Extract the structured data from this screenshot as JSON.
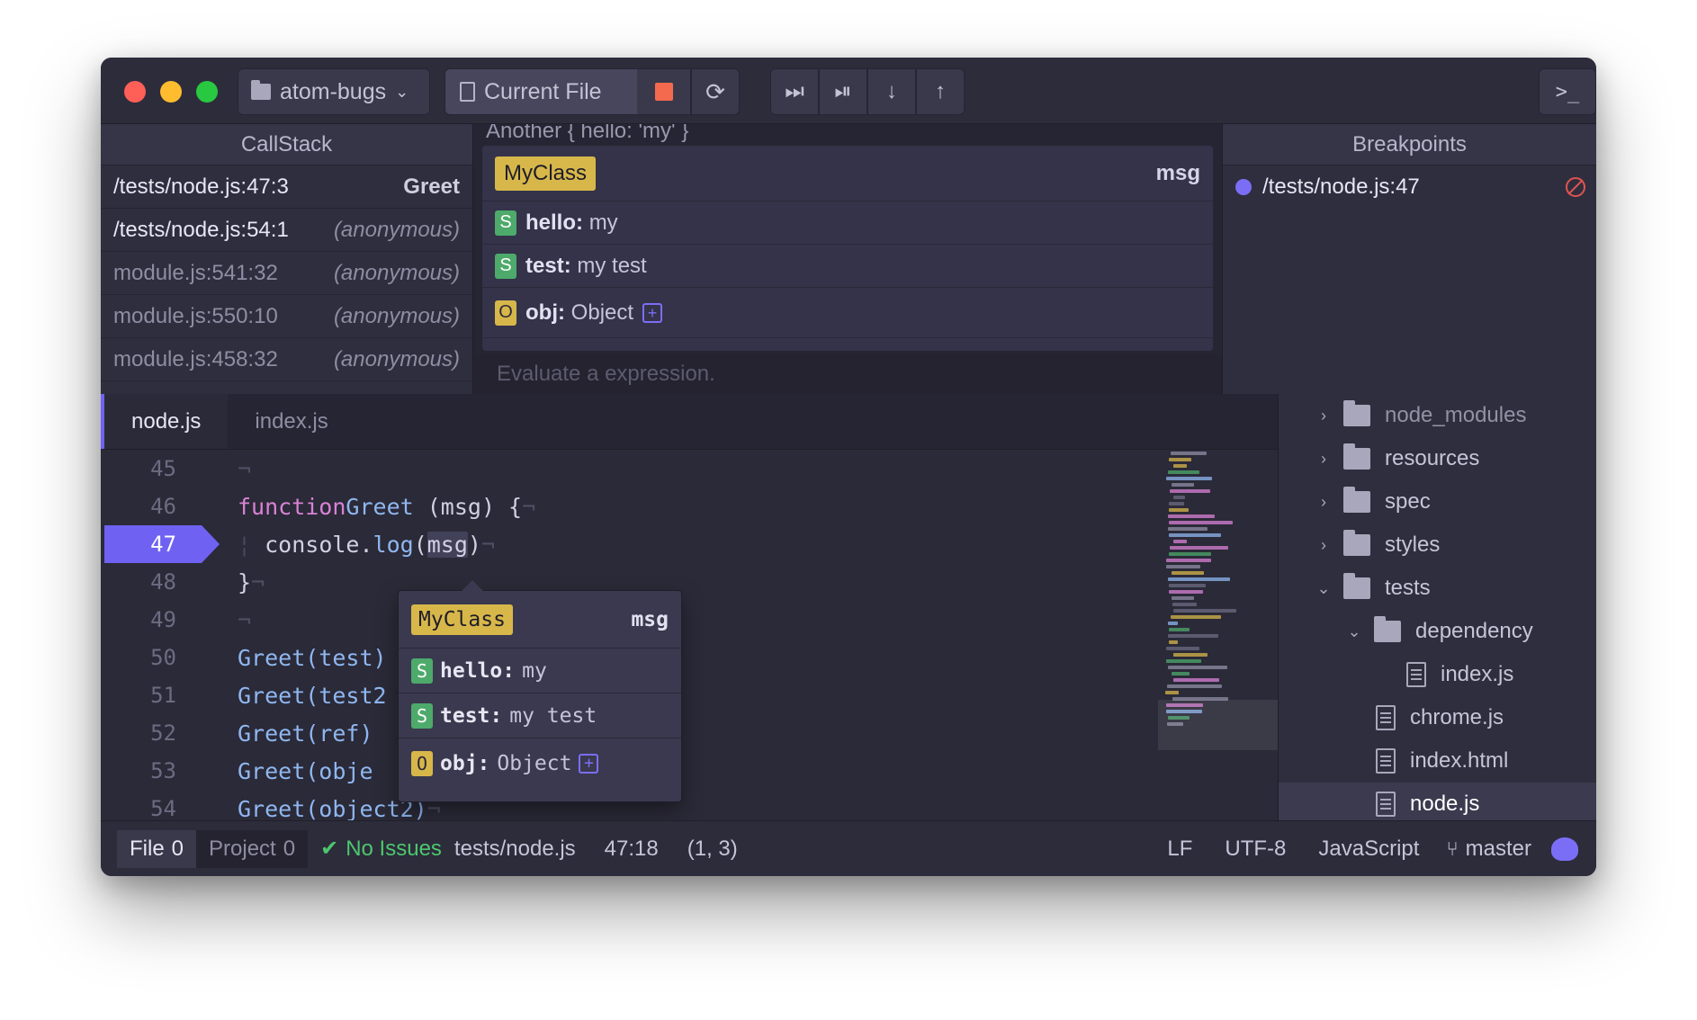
{
  "toolbar": {
    "project_label": "atom-bugs",
    "scope_label": "Current File",
    "reload_icon": "⟳",
    "step_over_icon": "⏭",
    "step_into_icon": "⏯",
    "step_down_icon": "↓",
    "step_out_icon": "↑",
    "terminal_icon": "⌨",
    "terminal_label": ">_"
  },
  "callstack": {
    "title": "CallStack",
    "frames": [
      {
        "location": "/tests/node.js:47:3",
        "function": "Greet"
      },
      {
        "location": "/tests/node.js:54:1",
        "function": "(anonymous)"
      },
      {
        "location": "module.js:541:32",
        "function": "(anonymous)"
      },
      {
        "location": "module.js:550:10",
        "function": "(anonymous)"
      },
      {
        "location": "module.js:458:32",
        "function": "(anonymous)"
      }
    ]
  },
  "variables": {
    "cut_header": "Another { hello: 'my' }",
    "class_name": "MyClass",
    "var_name": "msg",
    "rows": [
      {
        "type": "S",
        "key": "hello",
        "value": "my"
      },
      {
        "type": "S",
        "key": "test",
        "value": "my test"
      },
      {
        "type": "O",
        "key": "obj",
        "value": "Object",
        "expand": "+"
      }
    ],
    "eval_placeholder": "Evaluate a expression."
  },
  "breakpoints": {
    "title": "Breakpoints",
    "items": [
      {
        "location": "/tests/node.js:47"
      }
    ]
  },
  "editor": {
    "tabs": [
      "node.js",
      "index.js"
    ],
    "line_numbers": [
      "45",
      "46",
      "47",
      "48",
      "49",
      "50",
      "51",
      "52",
      "53",
      "54"
    ],
    "active_line": "47",
    "code": {
      "l46_kw": "function",
      "l46_fn": "Greet",
      "l46_rest": " (msg) {",
      "l47_obj": "console.",
      "l47_fn": "log",
      "l47_open": "(",
      "l47_arg": "msg",
      "l47_close": ")",
      "l48": "}",
      "l50": "Greet(test)",
      "l51": "Greet(test2",
      "l52": "Greet(ref)",
      "l53": "Greet(obje",
      "l54": "Greet(object2)",
      "eol": "¬"
    }
  },
  "tooltip": {
    "class_name": "MyClass",
    "var_name": "msg",
    "rows": [
      {
        "type": "S",
        "key": "hello:",
        "value": "my"
      },
      {
        "type": "S",
        "key": "test:",
        "value": "my test"
      },
      {
        "type": "O",
        "key": "obj:",
        "value": "Object",
        "expand": "+"
      }
    ]
  },
  "tree": {
    "items": [
      {
        "name": "node_modules",
        "kind": "folder",
        "state": "collapsed",
        "depth": 0
      },
      {
        "name": "resources",
        "kind": "folder",
        "state": "collapsed",
        "depth": 0
      },
      {
        "name": "spec",
        "kind": "folder",
        "state": "collapsed",
        "depth": 0
      },
      {
        "name": "styles",
        "kind": "folder",
        "state": "collapsed",
        "depth": 0
      },
      {
        "name": "tests",
        "kind": "folder",
        "state": "expanded",
        "depth": 0
      },
      {
        "name": "dependency",
        "kind": "folder",
        "state": "expanded",
        "depth": 1
      },
      {
        "name": "index.js",
        "kind": "file",
        "depth": 2
      },
      {
        "name": "chrome.js",
        "kind": "file",
        "depth": 1
      },
      {
        "name": "index.html",
        "kind": "file",
        "depth": 1
      },
      {
        "name": "node.js",
        "kind": "file",
        "depth": 1,
        "selected": true
      }
    ]
  },
  "statusbar": {
    "file_tab": "File",
    "file_count": "0",
    "project_tab": "Project",
    "project_count": "0",
    "issues": "No Issues",
    "path": "tests/node.js",
    "cursor": "47:18",
    "selection": "(1, 3)",
    "line_ending": "LF",
    "encoding": "UTF-8",
    "grammar": "JavaScript",
    "branch": "master"
  },
  "colors": {
    "accent": "#6f62f2",
    "class_badge": "#d8b74a",
    "string_badge": "#4daa6b",
    "ok": "#4cc76d",
    "stop": "#f46a4e"
  }
}
